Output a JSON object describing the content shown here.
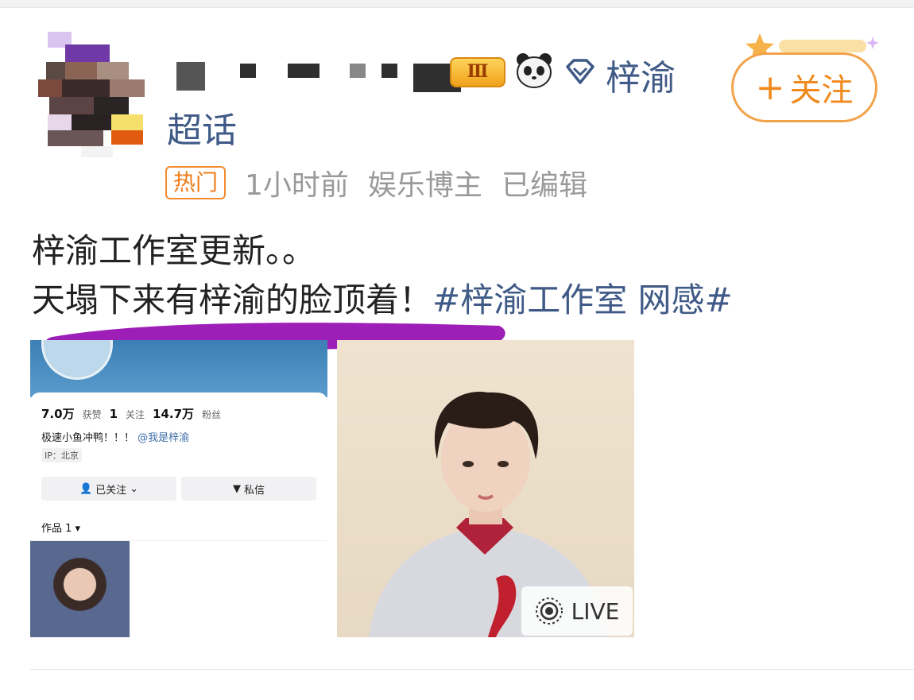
{
  "post": {
    "level_badge": "Ⅲ",
    "topic_name": "梓渝",
    "topic_suffix": "超话",
    "follow_label": "关注",
    "follow_plus": "+",
    "hot_badge": "热门",
    "time": "1小时前",
    "role": "娱乐博主",
    "edited": "已编辑",
    "line1": "梓渝工作室更新。。",
    "line2_text": "天塌下来有梓渝的脸顶着！",
    "hashtag": "#梓渝工作室 网感#"
  },
  "profile_shot": {
    "stats": [
      {
        "num": "7.0万",
        "label": "获赞"
      },
      {
        "num": "1",
        "label": "关注"
      },
      {
        "num": "14.7万",
        "label": "粉丝"
      }
    ],
    "bio_text": "极速小鱼冲鸭！！！",
    "bio_at": "@我是梓渝",
    "ip": "IP：北京",
    "followed_btn": "已关注",
    "message_btn": "私信",
    "works": "作品 1 ▾"
  },
  "portrait": {
    "live_label": "LIVE"
  },
  "colors": {
    "link": "#3f5a86",
    "accent_orange": "#f08a1e",
    "scribble_purple": "#9d1fb8"
  }
}
